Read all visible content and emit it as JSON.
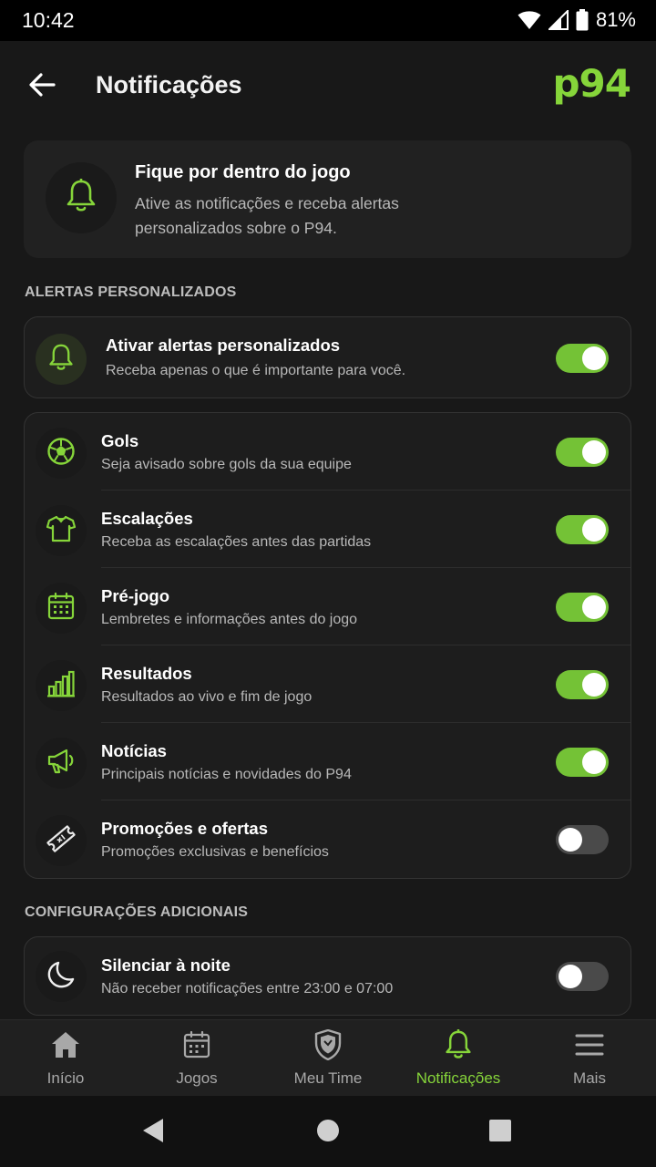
{
  "status_bar": {
    "time": "10:42",
    "battery": "81%"
  },
  "header": {
    "title": "Notificações",
    "brand": "p94"
  },
  "intro": {
    "title": "Fique por dentro do jogo",
    "text": "Ative as notificações e receba alertas personalizados sobre o P94.",
    "icon": "bell-icon"
  },
  "sections": {
    "alerts_label": "ALERTAS PERSONALIZADOS",
    "extra_label": "CONFIGURAÇÕES ADICIONAIS"
  },
  "master_alert": {
    "title": "Ativar alertas personalizados",
    "subtitle": "Receba apenas o que é importante para você.",
    "icon": "bell-icon",
    "enabled": true
  },
  "alert_items": [
    {
      "title": "Gols",
      "subtitle": "Seja avisado sobre gols da sua equipe",
      "icon": "soccer-ball-icon",
      "enabled": true
    },
    {
      "title": "Escalações",
      "subtitle": "Receba as escalações antes das partidas",
      "icon": "jersey-icon",
      "enabled": true
    },
    {
      "title": "Pré-jogo",
      "subtitle": "Lembretes e informações antes do jogo",
      "icon": "calendar-icon",
      "enabled": true
    },
    {
      "title": "Resultados",
      "subtitle": "Resultados ao vivo e fim de jogo",
      "icon": "bar-chart-icon",
      "enabled": true
    },
    {
      "title": "Notícias",
      "subtitle": "Principais notícias e novidades do P94",
      "icon": "megaphone-icon",
      "enabled": true
    },
    {
      "title": "Promoções e ofertas",
      "subtitle": "Promoções exclusivas e benefícios",
      "icon": "ticket-icon",
      "enabled": false
    }
  ],
  "night_silence": {
    "title": "Silenciar à noite",
    "subtitle": "Não receber notificações entre 23:00 e 07:00",
    "icon": "moon-icon",
    "enabled": false
  },
  "bottom_nav": [
    {
      "label": "Início",
      "icon": "home-icon",
      "active": false
    },
    {
      "label": "Jogos",
      "icon": "calendar-icon",
      "active": false
    },
    {
      "label": "Meu Time",
      "icon": "shield-icon",
      "active": false
    },
    {
      "label": "Notificações",
      "icon": "bell-icon",
      "active": true
    },
    {
      "label": "Mais",
      "icon": "menu-icon",
      "active": false
    }
  ],
  "colors": {
    "accent": "#86d53a",
    "toggle_on": "#74c236",
    "background": "#181818",
    "card": "#212121"
  }
}
